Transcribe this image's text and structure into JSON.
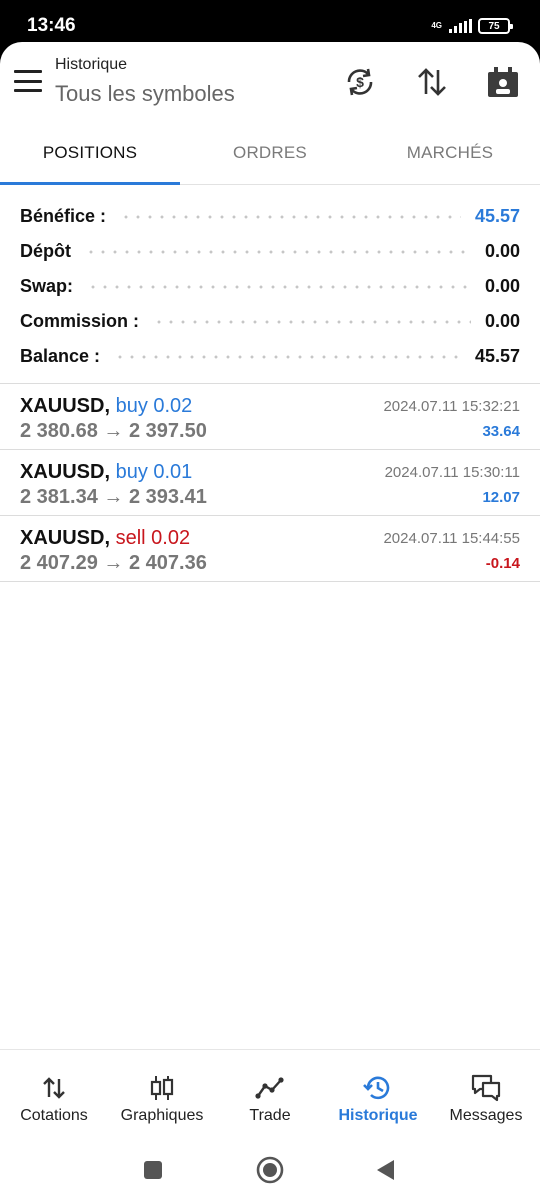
{
  "status": {
    "time": "13:46",
    "network": "4G",
    "battery": "75"
  },
  "header": {
    "title": "Historique",
    "subtitle": "Tous les symboles"
  },
  "tabs": [
    {
      "label": "POSITIONS",
      "active": true
    },
    {
      "label": "ORDRES",
      "active": false
    },
    {
      "label": "MARCHÉS",
      "active": false
    }
  ],
  "summary": [
    {
      "label": "Bénéfice :",
      "value": "45.57",
      "color": "#2a7ad9"
    },
    {
      "label": "Dépôt",
      "value": "0.00"
    },
    {
      "label": "Swap:",
      "value": "0.00"
    },
    {
      "label": "Commission :",
      "value": "0.00"
    },
    {
      "label": "Balance :",
      "value": "45.57"
    }
  ],
  "deals": [
    {
      "symbol": "XAUUSD,",
      "side": "buy 0.02",
      "prices": "2 380.68 → 2 397.50",
      "time": "2024.07.11 15:32:21",
      "profit": "33.64"
    },
    {
      "symbol": "XAUUSD,",
      "side": "buy 0.01",
      "prices": "2 381.34 → 2 393.41",
      "time": "2024.07.11 15:30:11",
      "profit": "12.07"
    },
    {
      "symbol": "XAUUSD,",
      "side": "sell 0.02",
      "prices": "2 407.29 → 2 407.36",
      "time": "2024.07.11 15:44:55",
      "profit": "-0.14"
    }
  ],
  "nav": [
    {
      "label": "Cotations",
      "icon": "quotes-arrows-icon"
    },
    {
      "label": "Graphiques",
      "icon": "candlestick-chart-icon"
    },
    {
      "label": "Trade",
      "icon": "trade-line-icon"
    },
    {
      "label": "Historique",
      "icon": "history-clock-icon",
      "active": true
    },
    {
      "label": "Messages",
      "icon": "chat-bubbles-icon"
    }
  ],
  "colors": {
    "accent": "#2a7ad9",
    "loss": "#c8161d"
  }
}
